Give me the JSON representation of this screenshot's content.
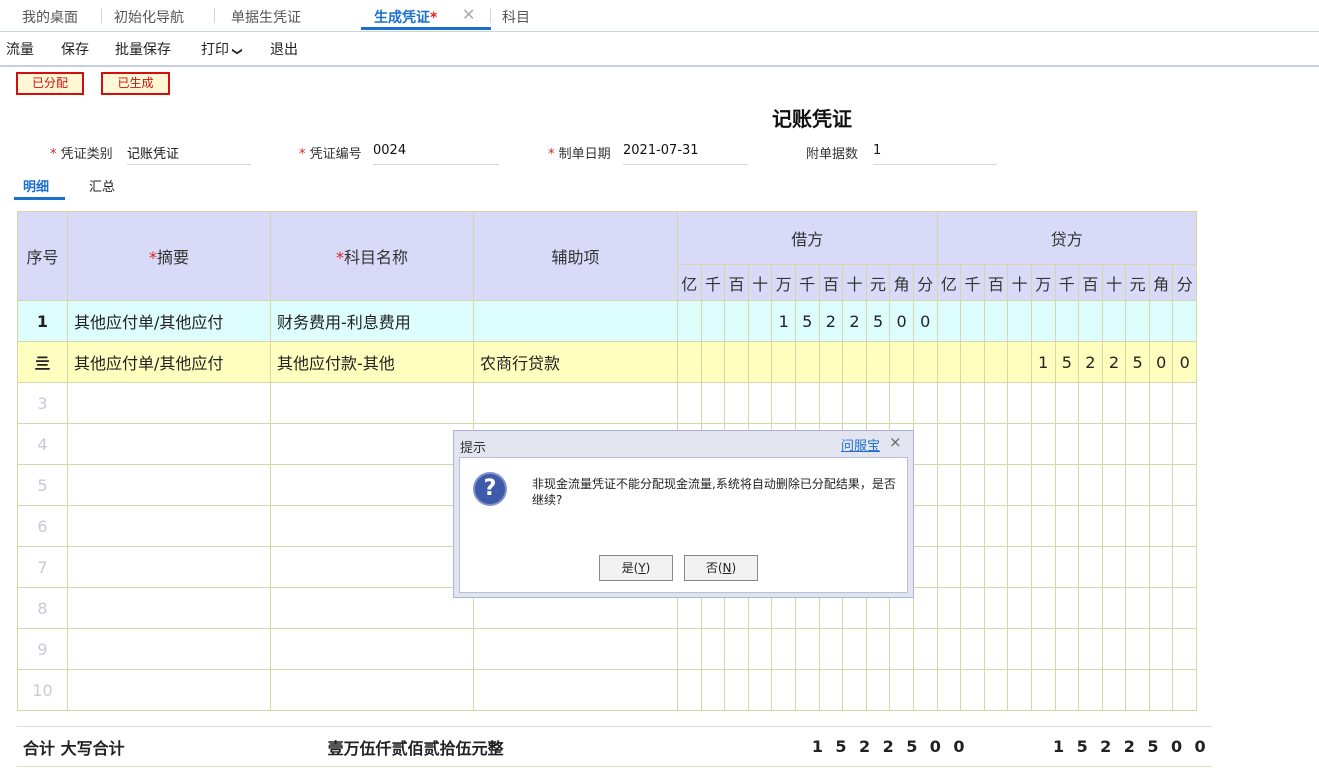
{
  "tabs": [
    {
      "label": "我的桌面"
    },
    {
      "label": "初始化导航"
    },
    {
      "label": "单据生凭证"
    },
    {
      "label": "生成凭证",
      "modified_mark": "*"
    },
    {
      "label": "科目"
    }
  ],
  "toolbar": {
    "items": [
      "流量",
      "保存",
      "批量保存",
      "打印",
      "退出"
    ],
    "dropdown_mark": "❯"
  },
  "status": {
    "allocated": "已分配",
    "generated": "已生成"
  },
  "title": "记账凭证",
  "header": {
    "required_mark": "*",
    "type_label": "凭证类别",
    "type_value": "记账凭证",
    "number_label": "凭证编号",
    "number_value": "0024",
    "date_label": "制单日期",
    "date_value": "2021-07-31",
    "attach_label": "附单据数",
    "attach_value": "1"
  },
  "subtabs": [
    "明细",
    "汇总"
  ],
  "table": {
    "headers": {
      "seq": "序号",
      "summary": "摘要",
      "account": "科目名称",
      "aux": "辅助项",
      "debit": "借方",
      "credit": "贷方"
    },
    "units": [
      "亿",
      "千",
      "百",
      "十",
      "万",
      "千",
      "百",
      "十",
      "元",
      "角",
      "分"
    ],
    "rows": [
      {
        "seq": "1",
        "summary": "其他应付单/其他应付",
        "account": "财务费用-利息费用",
        "aux": "",
        "debit": [
          "",
          "",
          "",
          "",
          "1",
          "5",
          "2",
          "2",
          "5",
          "0",
          "0"
        ],
        "credit": [
          "",
          "",
          "",
          "",
          "",
          "",
          "",
          "",
          "",
          "",
          ""
        ]
      },
      {
        "seq": "亖",
        "summary": "其他应付单/其他应付",
        "account": "其他应付款-其他",
        "aux": "农商行贷款",
        "debit": [
          "",
          "",
          "",
          "",
          "",
          "",
          "",
          "",
          "",
          "",
          ""
        ],
        "credit": [
          "",
          "",
          "",
          "",
          "1",
          "5",
          "2",
          "2",
          "5",
          "0",
          "0"
        ]
      },
      {
        "seq": "3"
      },
      {
        "seq": "4"
      },
      {
        "seq": "5"
      },
      {
        "seq": "6"
      },
      {
        "seq": "7"
      },
      {
        "seq": "8"
      },
      {
        "seq": "9"
      },
      {
        "seq": "10"
      }
    ]
  },
  "totals": {
    "label": "合计",
    "caps_label": "大写合计",
    "caps_value": "壹万伍仟贰佰贰拾伍元整",
    "debit_digits": [
      "1",
      "5",
      "2",
      "2",
      "5",
      "0",
      "0"
    ],
    "credit_digits": [
      "1",
      "5",
      "2",
      "2",
      "5",
      "0",
      "0"
    ]
  },
  "dialog": {
    "title": "提示",
    "link": "问服宝",
    "close": "×",
    "icon": "question-icon",
    "icon_glyph": "?",
    "message": "非现金流量凭证不能分配现金流量,系统将自动删除已分配结果，是否继续?",
    "yes_label": "是",
    "yes_key": "Y",
    "no_label": "否",
    "no_key": "N"
  }
}
